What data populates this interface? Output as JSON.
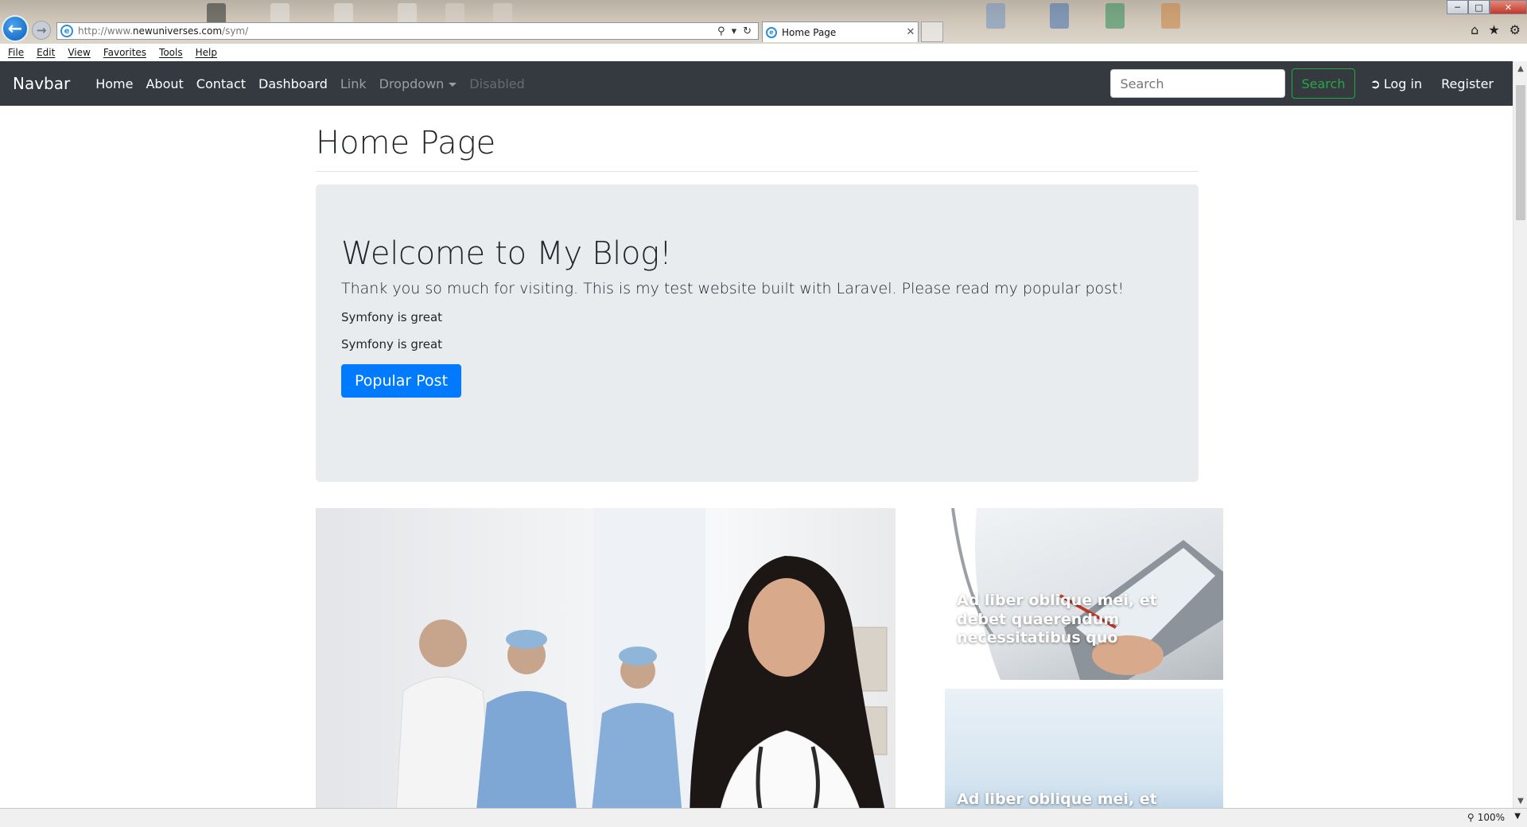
{
  "browser": {
    "url_prefix": "http://www.",
    "url_host": "newuniverses.com",
    "url_path": "/sym/",
    "tab_title": "Home Page",
    "menu": [
      "File",
      "Edit",
      "View",
      "Favorites",
      "Tools",
      "Help"
    ],
    "zoom": "100%",
    "accent_color": "#0b5fb8"
  },
  "navbar": {
    "brand": "Navbar",
    "links": [
      "Home",
      "About",
      "Contact",
      "Dashboard",
      "Link",
      "Dropdown",
      "Disabled"
    ],
    "search_placeholder": "Search",
    "search_button": "Search",
    "login": "Log in",
    "register": "Register",
    "background_color": "#343a40"
  },
  "page": {
    "title": "Home Page",
    "jumbotron": {
      "heading": "Welcome to My Blog!",
      "lead": "Thank you so much for visiting. This is my test website built with Laravel. Please read my popular post!",
      "line1": "Symfony is great",
      "line2": "Symfony is great",
      "button": "Popular Post",
      "button_color": "#007bff"
    },
    "cards": [
      {
        "caption": "Ad liber oblique mei, et debet quaerendum necessitatibus quo"
      },
      {
        "caption": "Ad liber oblique mei, et debet"
      }
    ]
  }
}
